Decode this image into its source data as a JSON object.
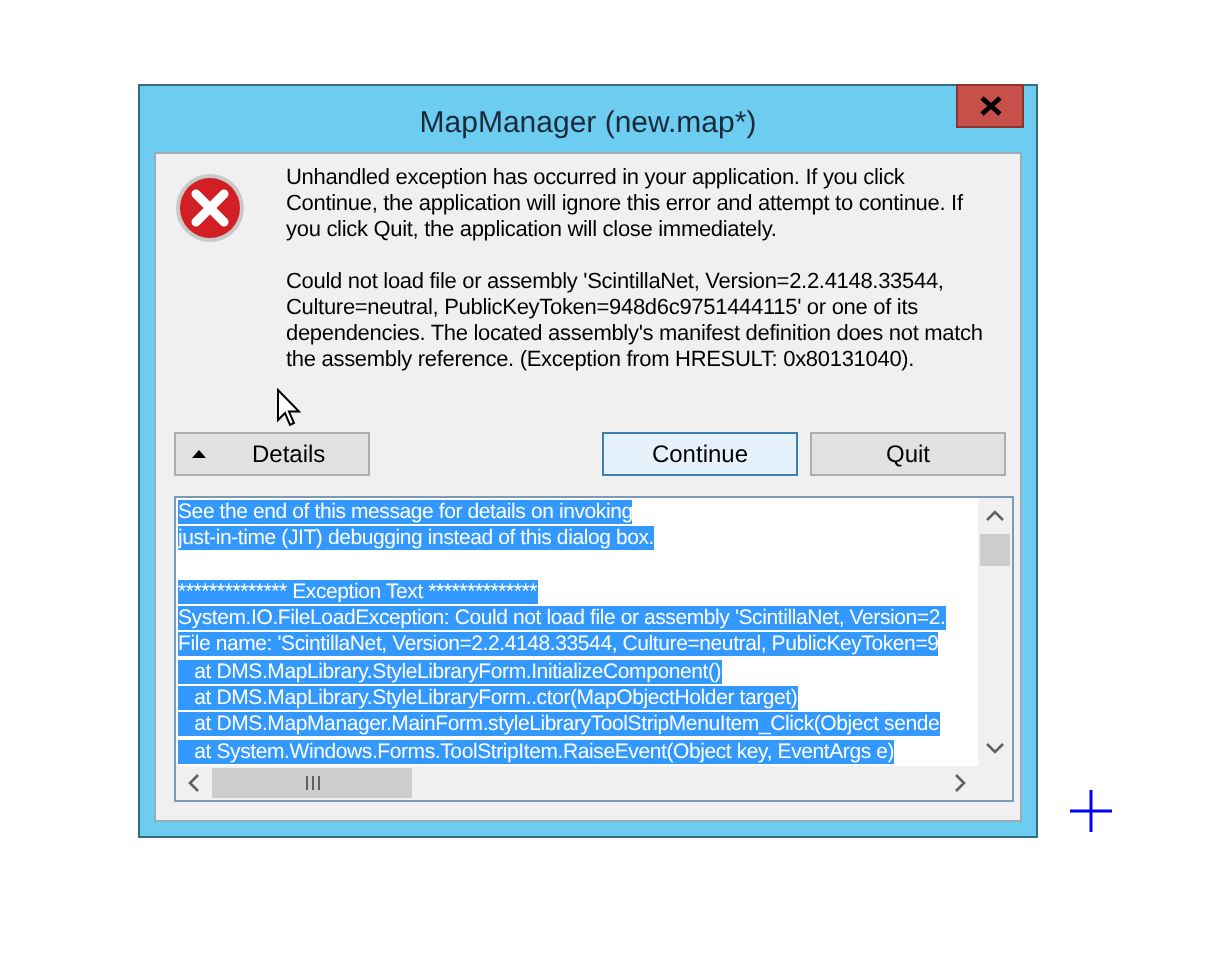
{
  "window": {
    "title": "MapManager (new.map*)"
  },
  "message": [
    "Unhandled exception has occurred in your application. If you click Continue, the application will ignore this error and attempt to continue. If you click Quit, the application will close immediately.",
    "Could not load file or assembly 'ScintillaNet, Version=2.2.4148.33544, Culture=neutral, PublicKeyToken=948d6c9751444115' or one of its dependencies. The located assembly's manifest definition does not match the assembly reference. (Exception from HRESULT: 0x80131040)."
  ],
  "buttons": [
    {
      "label": "Details",
      "kind": "details",
      "expanded": true,
      "default": false
    },
    {
      "label": "Continue",
      "kind": "action",
      "default": true
    },
    {
      "label": "Quit",
      "kind": "action",
      "default": false
    }
  ],
  "details": {
    "selected": true,
    "paragraphs": [
      [
        "See the end of this message for details on invoking",
        "just-in-time (JIT) debugging instead of this dialog box."
      ],
      [
        "************** Exception Text **************",
        "System.IO.FileLoadException: Could not load file or assembly 'ScintillaNet, Version=2.",
        "File name: 'ScintillaNet, Version=2.2.4148.33544, Culture=neutral, PublicKeyToken=9",
        "   at DMS.MapLibrary.StyleLibraryForm.InitializeComponent()",
        "   at DMS.MapLibrary.StyleLibraryForm..ctor(MapObjectHolder target)",
        "   at DMS.MapManager.MainForm.styleLibraryToolStripMenuItem_Click(Object sende",
        "   at System.Windows.Forms.ToolStripItem.RaiseEvent(Object key, EventArgs e)"
      ]
    ]
  }
}
